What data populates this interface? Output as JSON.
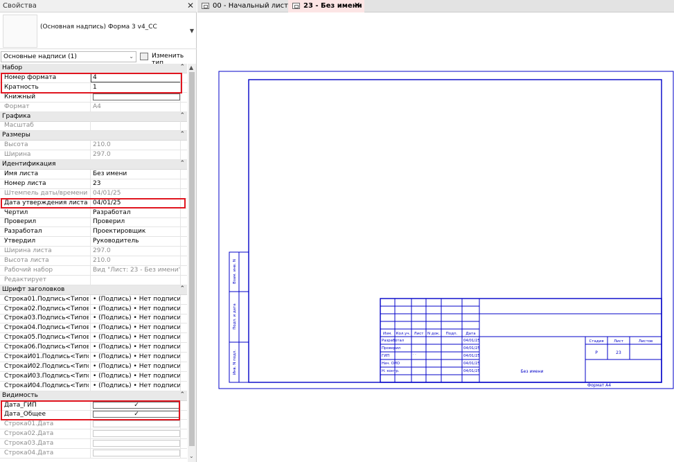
{
  "properties": {
    "title": "Свойства",
    "type_name": "(Основная надпись) Форма 3 v4_СС",
    "filter": "Основные надписи (1)",
    "edit_type": "Изменить тип",
    "groups": [
      {
        "label": "Набор",
        "rows": [
          {
            "label": "Номер формата",
            "value": "4",
            "editing": true
          },
          {
            "label": "Кратность",
            "value": "1"
          },
          {
            "label": "Книжный",
            "check": "empty"
          },
          {
            "label": "Формат",
            "value": "A4",
            "dis": true
          }
        ]
      },
      {
        "label": "Графика",
        "rows": [
          {
            "label": "Масштаб",
            "value": "",
            "dis": true
          }
        ]
      },
      {
        "label": "Размеры",
        "rows": [
          {
            "label": "Высота",
            "value": "210.0",
            "dis": true
          },
          {
            "label": "Ширина",
            "value": "297.0",
            "dis": true
          }
        ]
      },
      {
        "label": "Идентификация",
        "rows": [
          {
            "label": "Имя листа",
            "value": "Без имени"
          },
          {
            "label": "Номер листа",
            "value": "23"
          },
          {
            "label": "Штемпель даты/времени",
            "value": "04/01/25",
            "dis": true
          },
          {
            "label": "Дата утверждения листа",
            "value": "04/01/25"
          },
          {
            "label": "Чертил",
            "value": "Разработал"
          },
          {
            "label": "Проверил",
            "value": "Проверил"
          },
          {
            "label": "Разработал",
            "value": "Проектировщик"
          },
          {
            "label": "Утвердил",
            "value": "Руководитель"
          },
          {
            "label": "Ширина листа",
            "value": "297.0",
            "dis": true
          },
          {
            "label": "Высота листа",
            "value": "210.0",
            "dis": true
          },
          {
            "label": "Рабочий набор",
            "value": "Вид \"Лист: 23 - Без имени\"",
            "dis": true
          },
          {
            "label": "Редактирует",
            "value": "",
            "dis": true
          }
        ]
      },
      {
        "label": "Шрифт заголовков",
        "rows": [
          {
            "label": "Строка01.Подпись<Типов...",
            "value": "• (Подпись) • Нет подписи : •"
          },
          {
            "label": "Строка02.Подпись<Типов...",
            "value": "• (Подпись) • Нет подписи : •"
          },
          {
            "label": "Строка03.Подпись<Типов...",
            "value": "• (Подпись) • Нет подписи : •"
          },
          {
            "label": "Строка04.Подпись<Типов...",
            "value": "• (Подпись) • Нет подписи : •"
          },
          {
            "label": "Строка05.Подпись<Типов...",
            "value": "• (Подпись) • Нет подписи : •"
          },
          {
            "label": "Строка06.Подпись<Типов...",
            "value": "• (Подпись) • Нет подписи : •"
          },
          {
            "label": "СтрокаИ01.Подпись<Типо...",
            "value": "• (Подпись) • Нет подписи : •"
          },
          {
            "label": "СтрокаИ02.Подпись<Типо...",
            "value": "• (Подпись) • Нет подписи : •"
          },
          {
            "label": "СтрокаИ03.Подпись<Типо...",
            "value": "• (Подпись) • Нет подписи : •"
          },
          {
            "label": "СтрокаИ04.Подпись<Типо...",
            "value": "• (Подпись) • Нет подписи : •"
          }
        ]
      },
      {
        "label": "Видимость",
        "rows": [
          {
            "label": "Дата_ГИП",
            "check": "on"
          },
          {
            "label": "Дата_Общее",
            "check": "on"
          },
          {
            "label": "Строка01.Дата",
            "check": "dis",
            "dis": true
          },
          {
            "label": "Строка02.Дата",
            "check": "dis",
            "dis": true
          },
          {
            "label": "Строка03.Дата",
            "check": "dis",
            "dis": true
          },
          {
            "label": "Строка04.Дата",
            "check": "dis",
            "dis": true
          }
        ]
      }
    ]
  },
  "tabs": [
    {
      "label": "00 - Начальный лист"
    },
    {
      "label": "23 - Без имени",
      "active": true
    }
  ],
  "sheet": {
    "side_labels": [
      "Взам. инв. N",
      "Подп. и дата",
      "Инв. N подл."
    ],
    "header_cells": [
      "Изм.",
      "Кол.уч.",
      "Лист",
      "N док.",
      "Подп.",
      "Дата"
    ],
    "people_rows": [
      "Разработал",
      "Проверил",
      "ГИП",
      "Нач. ОИО",
      "Н. контр."
    ],
    "dates": [
      "04/01/25",
      "04/01/25",
      "04/01/25",
      "04/01/25",
      "04/01/25"
    ],
    "stage_headers": [
      "Стадия",
      "Лист",
      "Листов"
    ],
    "stage_values": [
      "P",
      "23",
      ""
    ],
    "sheet_name": "Без имени",
    "format": "Формат A4",
    "dots": "· ·"
  }
}
